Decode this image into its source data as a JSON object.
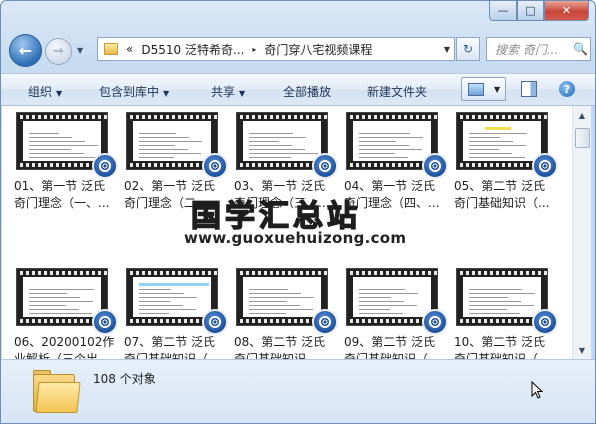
{
  "window": {
    "caption_buttons": {
      "minimize": "—",
      "maximize": "□",
      "close": "✕"
    }
  },
  "nav": {
    "back_glyph": "←",
    "forward_glyph": "→",
    "history_glyph": "▼",
    "breadcrumb_overflow": "«",
    "breadcrumb": [
      "D5510 泛特希奇...",
      "奇门穿八宅视频课程"
    ],
    "separator": "▸",
    "address_dropdown": "▼",
    "refresh_glyph": "↻",
    "search_placeholder": "搜索 奇门...",
    "search_glyph": "🔍"
  },
  "toolbar": {
    "organize": "组织",
    "include_in_library": "包含到库中",
    "share": "共享",
    "play_all": "全部播放",
    "new_folder": "新建文件夹",
    "dropdown_glyph": "▼",
    "help_glyph": "?"
  },
  "files": [
    {
      "line1": "01、第一节 泛氏",
      "line2": "奇门理念（一、..."
    },
    {
      "line1": "02、第一节 泛氏",
      "line2": "奇门理念（二、..."
    },
    {
      "line1": "03、第一节 泛氏",
      "line2": "奇门理念（三、..."
    },
    {
      "line1": "04、第一节 泛氏",
      "line2": "奇门理念（四、..."
    },
    {
      "line1": "05、第二节 泛氏",
      "line2": "奇门基础知识（..."
    },
    {
      "line1": "06、20200102作",
      "line2": "业解析（三个出..."
    },
    {
      "line1": "07、第二节 泛氏",
      "line2": "奇门基础知识（..."
    },
    {
      "line1": "08、第二节 泛氏",
      "line2": "奇门基础知识..."
    },
    {
      "line1": "09、第二节 泛氏",
      "line2": "奇门基础知识（..."
    },
    {
      "line1": "10、第二节 泛氏",
      "line2": "奇门基础知识（..."
    }
  ],
  "watermark": {
    "title": "国学汇总站",
    "url": "www.guoxuehuizong.com"
  },
  "scrollbar": {
    "up": "▲",
    "down": "▼"
  },
  "details": {
    "object_count": "108 个对象"
  }
}
